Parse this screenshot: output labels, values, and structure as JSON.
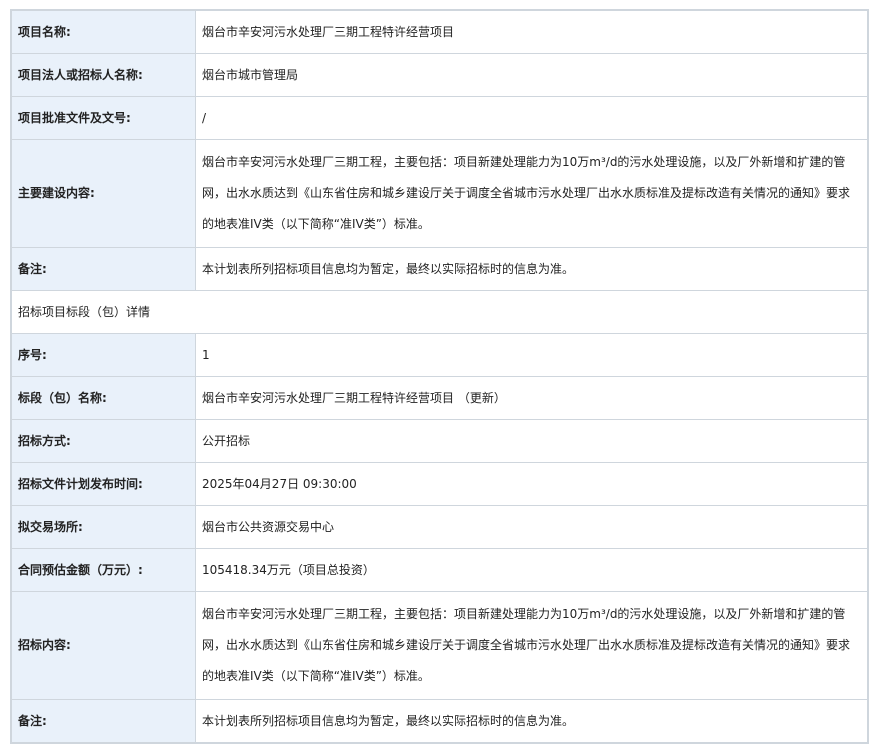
{
  "rows": [
    {
      "label": "项目名称:",
      "value": "烟台市辛安河污水处理厂三期工程特许经营项目"
    },
    {
      "label": "项目法人或招标人名称:",
      "value": "烟台市城市管理局"
    },
    {
      "label": "项目批准文件及文号:",
      "value": "/"
    },
    {
      "label": "主要建设内容:",
      "value": "烟台市辛安河污水处理厂三期工程，主要包括：项目新建处理能力为10万m³/d的污水处理设施，以及厂外新增和扩建的管网，出水水质达到《山东省住房和城乡建设厅关于调度全省城市污水处理厂出水水质标准及提标改造有关情况的通知》要求的地表准IV类（以下简称“准IV类”）标准。"
    },
    {
      "label": "备注:",
      "value": "本计划表所列招标项目信息均为暂定，最终以实际招标时的信息为准。"
    }
  ],
  "section_title": "招标项目标段（包）详情",
  "section_rows": [
    {
      "label": "序号:",
      "value": "1"
    },
    {
      "label": "标段（包）名称:",
      "value": "烟台市辛安河污水处理厂三期工程特许经营项目 （更新）"
    },
    {
      "label": "招标方式:",
      "value": "公开招标"
    },
    {
      "label": "招标文件计划发布时间:",
      "value": "2025年04月27日 09:30:00"
    },
    {
      "label": "拟交易场所:",
      "value": "烟台市公共资源交易中心"
    },
    {
      "label": "合同预估金额（万元）:",
      "value": "105418.34万元（项目总投资）"
    },
    {
      "label": "招标内容:",
      "value": "烟台市辛安河污水处理厂三期工程，主要包括：项目新建处理能力为10万m³/d的污水处理设施，以及厂外新增和扩建的管网，出水水质达到《山东省住房和城乡建设厅关于调度全省城市污水处理厂出水水质标准及提标改造有关情况的通知》要求的地表准IV类（以下简称“准IV类”）标准。"
    },
    {
      "label": "备注:",
      "value": "本计划表所列招标项目信息均为暂定，最终以实际招标时的信息为准。"
    }
  ]
}
